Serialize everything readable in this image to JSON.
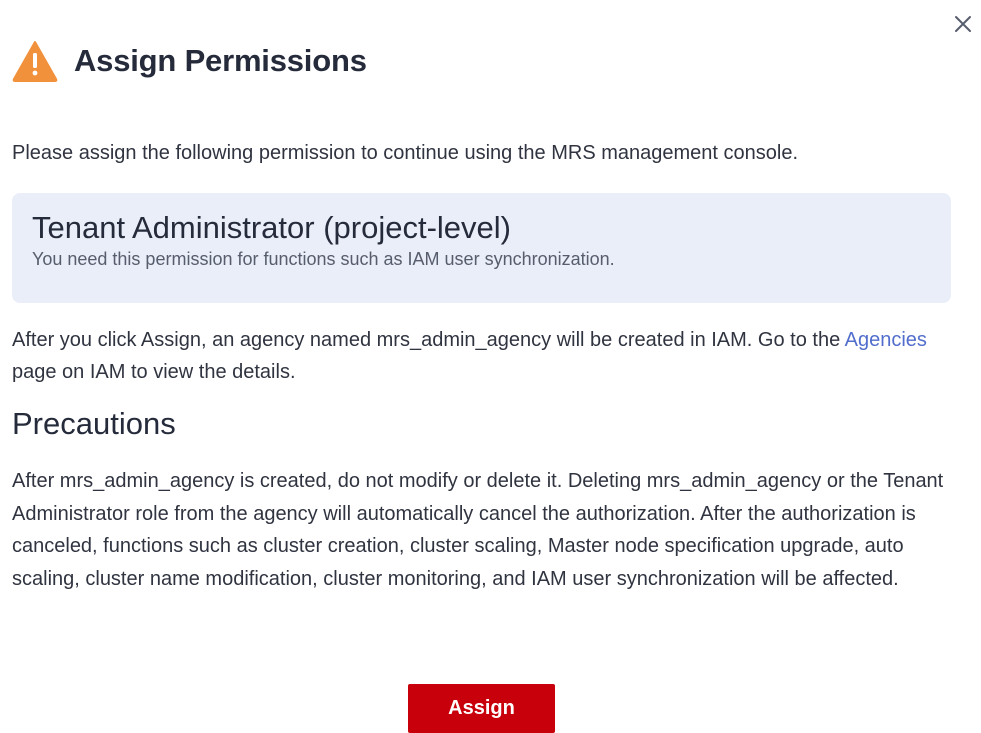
{
  "dialog": {
    "title": "Assign Permissions",
    "intro": "Please assign the following permission to continue using the MRS management console.",
    "permission": {
      "name": "Tenant Administrator (project-level)",
      "description": "You need this permission for functions such as IAM user synchronization."
    },
    "info": {
      "before_link": "After you click Assign, an agency named mrs_admin_agency will be created in IAM. Go to the ",
      "link_label": "Agencies",
      "after_link": " page on IAM to view the details."
    },
    "precautions": {
      "heading": "Precautions",
      "text": "After mrs_admin_agency is created, do not modify or delete it. Deleting mrs_admin_agency or the Tenant Administrator role from the agency will automatically cancel the authorization. After the authorization is canceled, functions such as cluster creation, cluster scaling, Master node specification upgrade, auto scaling, cluster name modification, cluster monitoring, and IAM user synchronization will be affected."
    },
    "assign_button": "Assign"
  },
  "icons": {
    "header": "warning-icon",
    "close": "close-icon"
  },
  "colors": {
    "warning": "#f2913c",
    "primary_button": "#c7000b",
    "link": "#526ecc",
    "info_box_bg": "#e9eef9"
  }
}
